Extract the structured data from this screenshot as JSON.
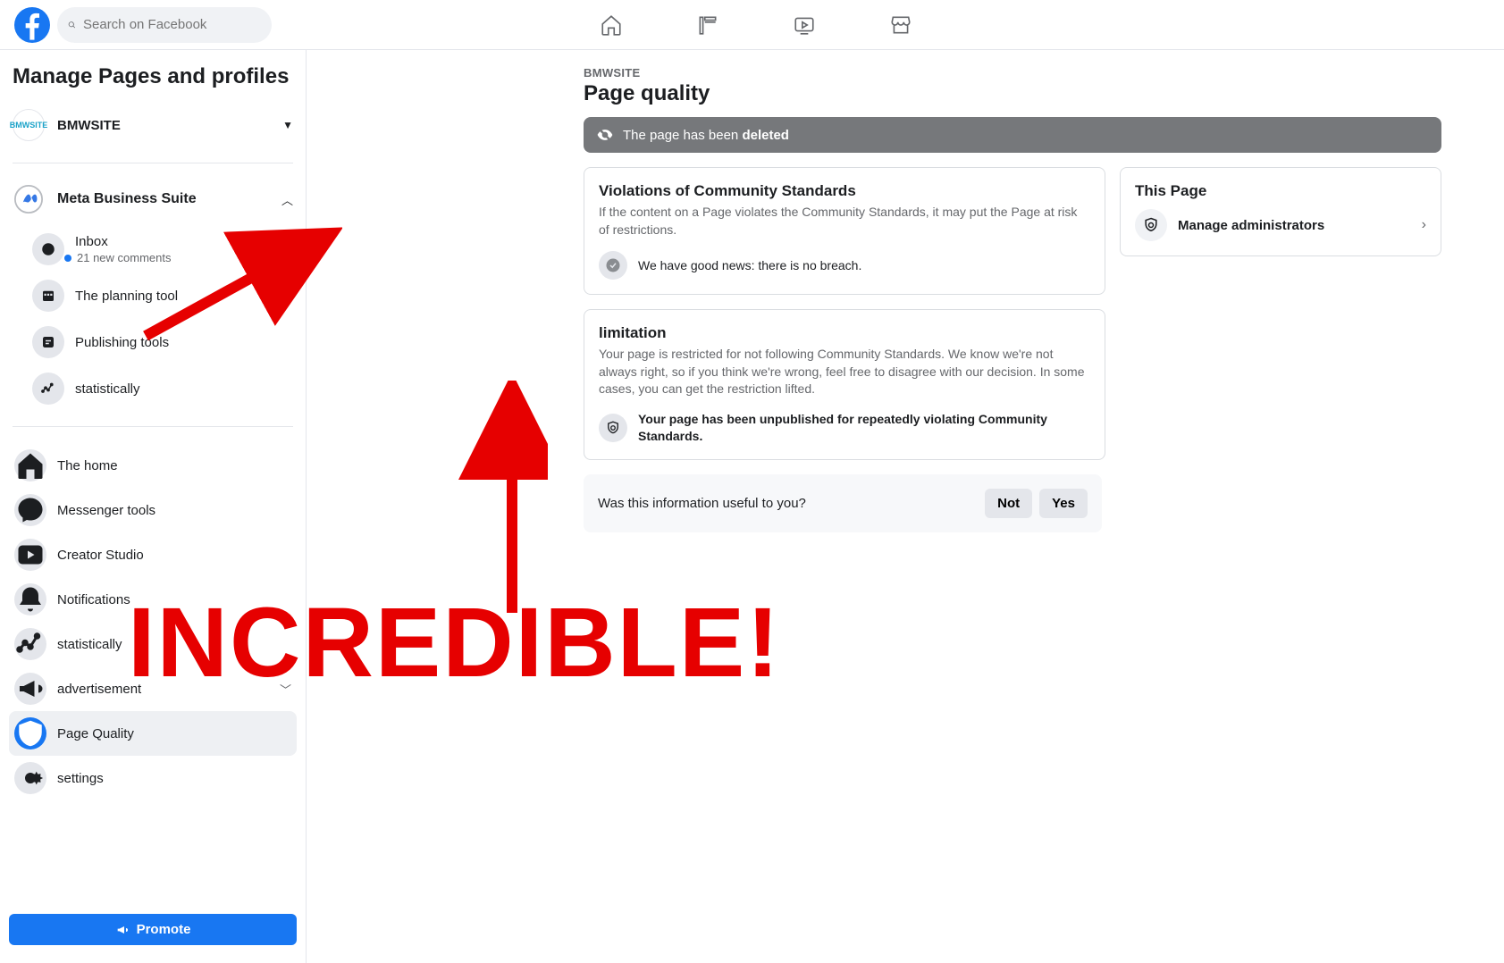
{
  "search": {
    "placeholder": "Search on Facebook"
  },
  "sidebar": {
    "title": "Manage Pages and profiles",
    "page_name": "BMWSITE",
    "page_logo_text": "BMWSITE",
    "meta_suite_label": "Meta Business Suite",
    "sub": {
      "inbox": "Inbox",
      "inbox_meta": "21 new comments",
      "planning": "The planning tool",
      "publishing": "Publishing tools",
      "stats": "statistically"
    },
    "nav": {
      "home": "The home",
      "messenger": "Messenger tools",
      "creator": "Creator Studio",
      "notifications": "Notifications",
      "stats": "statistically",
      "ads": "advertisement",
      "quality": "Page Quality",
      "settings": "settings"
    },
    "promote": "Promote"
  },
  "main": {
    "crumb": "BMWSITE",
    "title": "Page quality",
    "banner_prefix": "The page has been ",
    "banner_bold": "deleted",
    "card1": {
      "title": "Violations of Community Standards",
      "desc": "If the content on a Page violates the Community Standards, it may put the Page at risk of restrictions.",
      "status": "We have good news: there is no breach."
    },
    "card2": {
      "title": "limitation",
      "desc": "Your page is restricted for not following Community Standards. We know we're not always right, so if you think we're wrong, feel free to disagree with our decision. In some cases, you can get the restriction lifted.",
      "status": "Your page has been unpublished for repeatedly violating Community Standards."
    },
    "feedback": {
      "q": "Was this information useful to you?",
      "no": "Not",
      "yes": "Yes"
    },
    "right": {
      "title": "This Page",
      "manage": "Manage administrators"
    }
  },
  "annotation": {
    "big": "INCREDIBLE!"
  }
}
